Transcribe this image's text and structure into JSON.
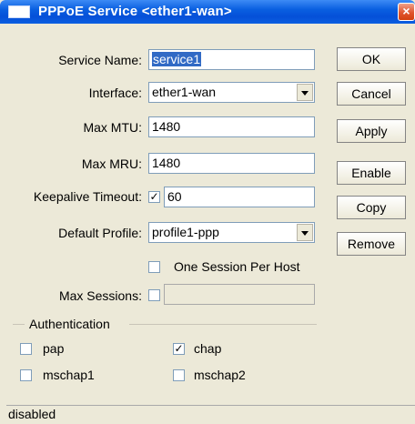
{
  "window": {
    "title": "PPPoE Service <ether1-wan>",
    "close_symbol": "×"
  },
  "form": {
    "service_name": {
      "label": "Service Name:",
      "value": "service1"
    },
    "interface": {
      "label": "Interface:",
      "value": "ether1-wan"
    },
    "max_mtu": {
      "label": "Max MTU:",
      "value": "1480"
    },
    "max_mru": {
      "label": "Max MRU:",
      "value": "1480"
    },
    "keepalive_timeout": {
      "label": "Keepalive Timeout:",
      "value": "60",
      "checked": true
    },
    "default_profile": {
      "label": "Default Profile:",
      "value": "profile1-ppp"
    },
    "one_session_per_host": {
      "label": "One Session Per Host",
      "checked": false
    },
    "max_sessions": {
      "label": "Max Sessions:",
      "value": "",
      "checked": false
    }
  },
  "authentication": {
    "title": "Authentication",
    "pap": {
      "label": "pap",
      "checked": false
    },
    "chap": {
      "label": "chap",
      "checked": true
    },
    "mschap1": {
      "label": "mschap1",
      "checked": false
    },
    "mschap2": {
      "label": "mschap2",
      "checked": false
    }
  },
  "buttons": {
    "ok": "OK",
    "cancel": "Cancel",
    "apply": "Apply",
    "enable": "Enable",
    "copy": "Copy",
    "remove": "Remove"
  },
  "status_bar": {
    "text": "disabled"
  },
  "check_mark": "✓",
  "colors": {
    "titlebar": "#0550d8",
    "dialog_bg": "#ece9d8",
    "selection": "#316ac5"
  }
}
